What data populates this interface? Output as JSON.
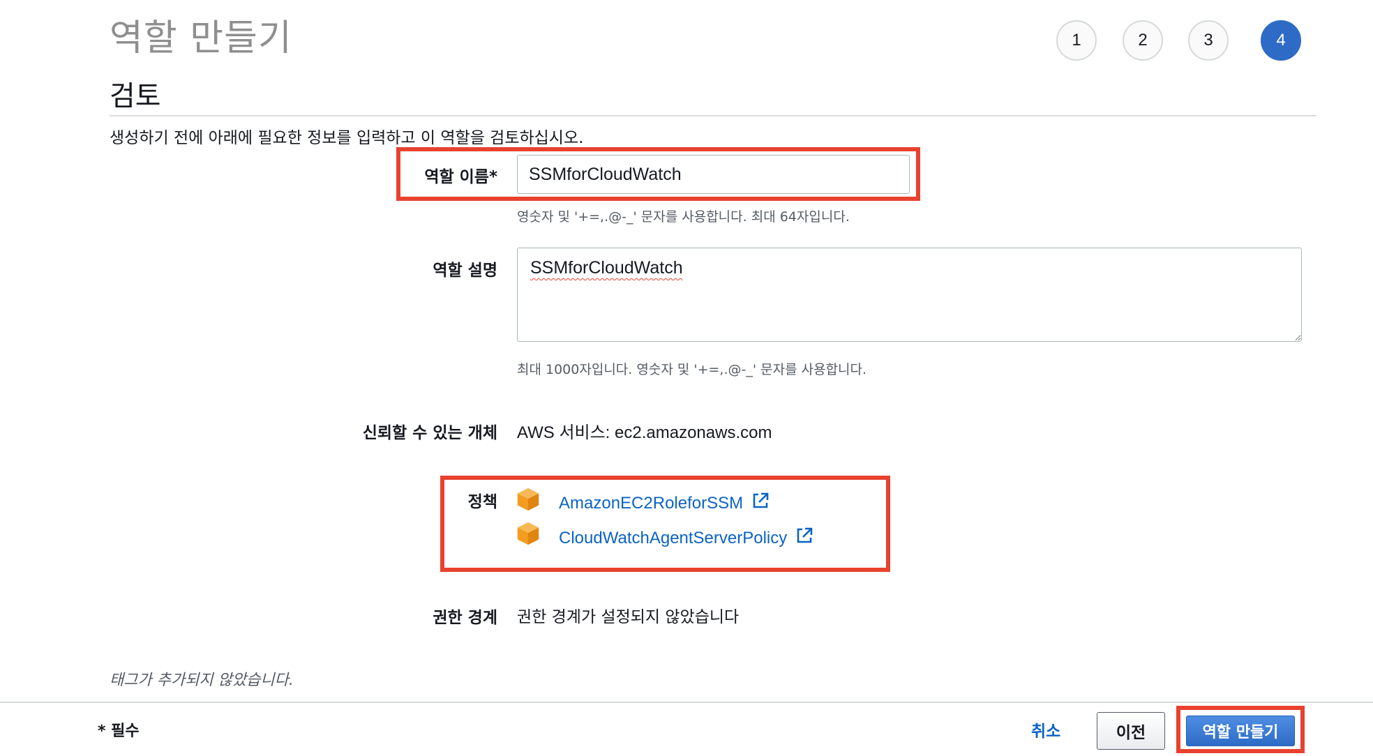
{
  "header": {
    "page_title": "역할 만들기",
    "steps": [
      {
        "label": "1",
        "active": false
      },
      {
        "label": "2",
        "active": false
      },
      {
        "label": "3",
        "active": false
      },
      {
        "label": "4",
        "active": true
      }
    ]
  },
  "review": {
    "section_title": "검토",
    "intro": "생성하기 전에 아래에 필요한 정보를 입력하고 이 역할을 검토하십시오.",
    "role_name": {
      "label": "역할 이름*",
      "value": "SSMforCloudWatch",
      "hint": "영숫자 및 '+=,.@-_' 문자를 사용합니다. 최대 64자입니다."
    },
    "role_description": {
      "label": "역할 설명",
      "value": "SSMforCloudWatch",
      "hint": "최대 1000자입니다. 영숫자 및 '+=,.@-_' 문자를 사용합니다."
    },
    "trusted_entity": {
      "label": "신뢰할 수 있는 개체",
      "value": "AWS 서비스: ec2.amazonaws.com"
    },
    "policies": {
      "label": "정책",
      "items": [
        {
          "name": "AmazonEC2RoleforSSM",
          "icon": "policy-box-icon"
        },
        {
          "name": "CloudWatchAgentServerPolicy",
          "icon": "policy-box-icon"
        }
      ]
    },
    "permissions_boundary": {
      "label": "권한 경계",
      "value": "권한 경계가 설정되지 않았습니다"
    },
    "tags_note": "태그가 추가되지 않았습니다."
  },
  "footer": {
    "required_note": "* 필수",
    "cancel_label": "취소",
    "previous_label": "이전",
    "create_label": "역할 만들기"
  },
  "colors": {
    "accent": "#2e6bc6",
    "link": "#0b63c5",
    "highlight": "#e8422f",
    "policy_icon": "#f5a623"
  }
}
